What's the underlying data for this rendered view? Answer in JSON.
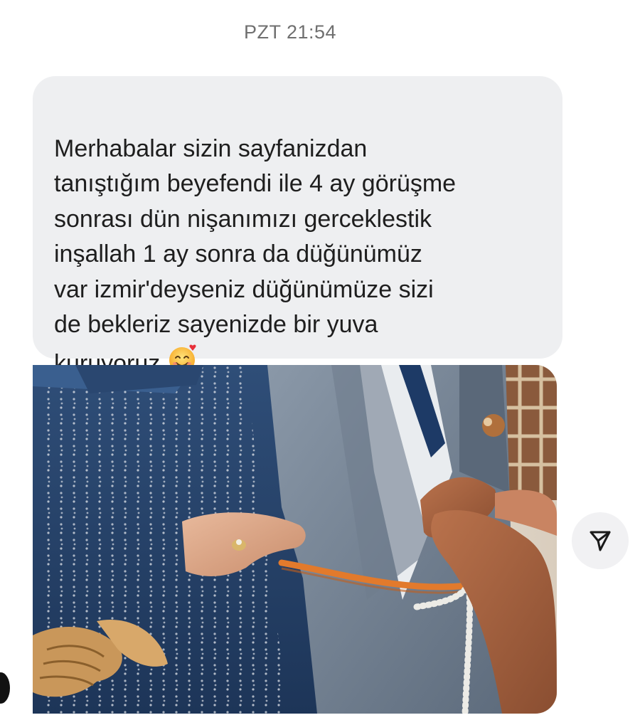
{
  "chat": {
    "timestamp": "PZT 21:54",
    "message": {
      "text": "Merhabalar sizin sayfanizdan\ntanıştığım beyefendi ile 4 ay görüşme\nsonrası dün nişanımızı gerceklestik\ninşallah 1 ay sonra da düğünümüz\nvar izmir'deyseniz düğünümüze sizi\nde bekleriz sayenizde bir yuva\nkuruyoruz",
      "emoji": "smiling-face-with-hearts",
      "bubble_color": "#eeeff1"
    },
    "photo": {
      "icon": "engagement-photo"
    },
    "share_icon": "paper-plane-icon"
  }
}
